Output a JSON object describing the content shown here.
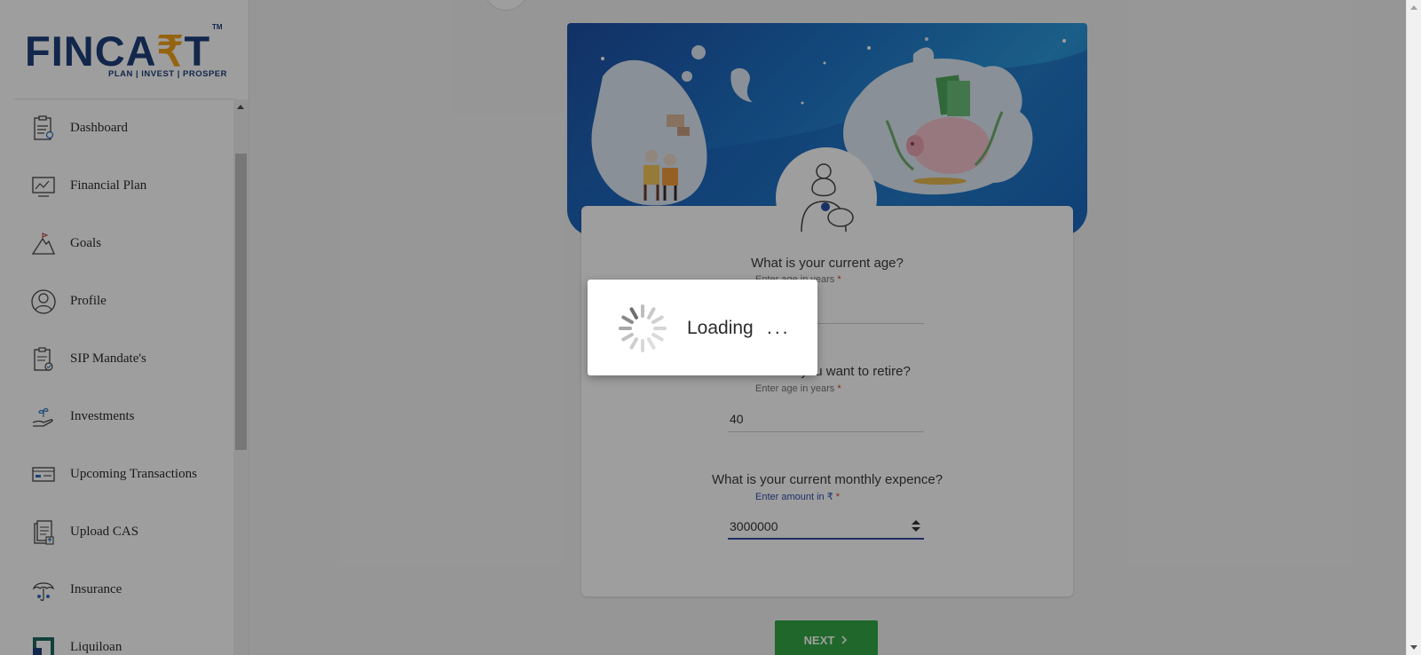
{
  "brand": {
    "logo_text_before": "FINCA",
    "logo_rupee": "₹",
    "logo_text_after": "T",
    "trademark": "TM",
    "tagline": "PLAN | INVEST | PROSPER"
  },
  "sidebar": {
    "items": [
      {
        "label": "Dashboard",
        "icon": "dashboard-icon"
      },
      {
        "label": "Financial Plan",
        "icon": "financial-plan-icon"
      },
      {
        "label": "Goals",
        "icon": "goals-icon"
      },
      {
        "label": "Profile",
        "icon": "profile-icon"
      },
      {
        "label": "SIP Mandate's",
        "icon": "sip-mandate-icon"
      },
      {
        "label": "Investments",
        "icon": "investments-icon"
      },
      {
        "label": "Upcoming Transactions",
        "icon": "upcoming-transactions-icon"
      },
      {
        "label": "Upload CAS",
        "icon": "upload-cas-icon"
      },
      {
        "label": "Insurance",
        "icon": "insurance-icon"
      },
      {
        "label": "Liquiloan",
        "icon": "liquiloan-icon"
      }
    ]
  },
  "form": {
    "q1": {
      "question": "What is your current age?",
      "hint": "Enter age in years",
      "required_mark": "*",
      "value": ""
    },
    "q2": {
      "question": "When do you want to retire?",
      "hint": "Enter age in years",
      "required_mark": "*",
      "value": "40"
    },
    "q3": {
      "question": "What is your current monthly expence?",
      "hint": "Enter amount in ₹",
      "required_mark": "*",
      "value": "3000000"
    },
    "next_label": "NEXT",
    "next_icon": "chevron-right-icon"
  },
  "loading": {
    "text": "Loading",
    "dots": "..."
  },
  "colors": {
    "brand_blue": "#1d3f7a",
    "brand_orange": "#f0a21c",
    "next_green": "#33a644",
    "active_field": "#3049a0"
  }
}
